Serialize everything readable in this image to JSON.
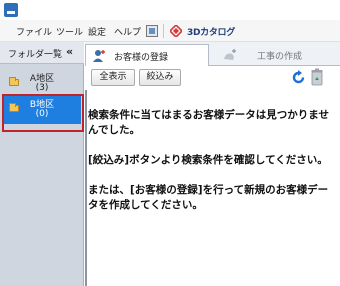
{
  "menu": {
    "items": [
      "ファイル",
      "ツール",
      "設定",
      "ヘルプ"
    ],
    "brand": "3Dカタログ"
  },
  "sidebar": {
    "title": "フォルダ一覧",
    "collapse": "«",
    "folders": [
      {
        "name": "A地区",
        "count": "(3)"
      },
      {
        "name": "B地区",
        "count": "(0)"
      }
    ]
  },
  "tabs": {
    "customer": "お客様の登録",
    "work": "工事の作成"
  },
  "toolbar": {
    "show_all": "全表示",
    "filter": "絞込み"
  },
  "message": {
    "line1": "検索条件に当てはまるお客様データは見つかりませんでした。",
    "line2": "[絞込み]ボタンより検索条件を確認してください。",
    "line3": "または、[お客様の登録]を行って新規のお客様データを作成してください。"
  },
  "colors": {
    "selected": "#1f7fe0",
    "highlight": "#c0242b",
    "sidebar": "#cfd6df"
  }
}
